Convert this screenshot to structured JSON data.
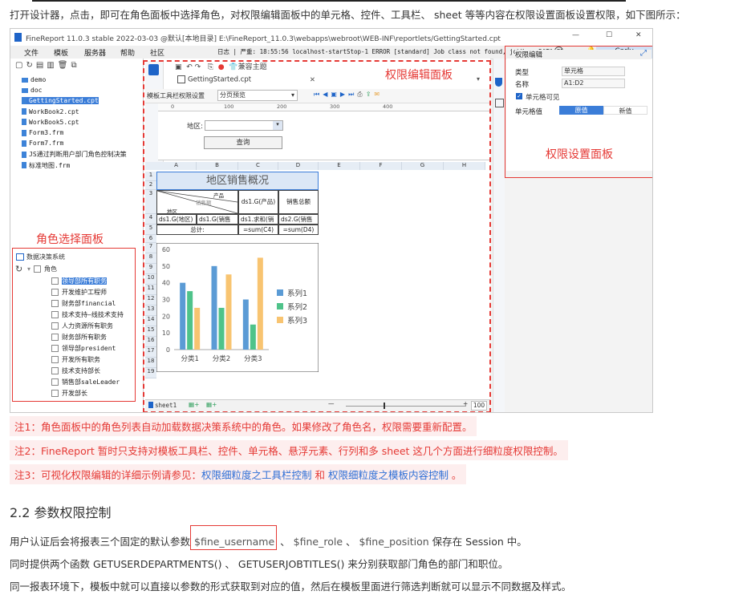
{
  "intro_text": "打开设计器，点击，即可在角色面板中选择角色，对权限编辑面板中的单元格、控件、工具栏、 sheet 等等内容在权限设置面板设置权限，如下图所示：",
  "app": {
    "title": "FineReport 11.0.3 stable 2022-03-03 @默认[本地目录]   E:\\FineReport_11.0.3\\webapps\\webroot\\WEB-INF\\reportlets/GettingStarted.cpt",
    "window_controls": [
      "—",
      "☐",
      "✕"
    ],
    "menu": [
      "文件",
      "模板",
      "服务器",
      "帮助",
      "社区"
    ],
    "log_text": "日志 | 严重: 18:55:56 localhost-startStop-1 ERROR [standard] Job class not found, jobKey: DATA_PRE...",
    "user": "Carly",
    "theme_label": "兼容主题",
    "tab_name": "GettingStarted.cpt",
    "file_tree": [
      {
        "type": "folder",
        "name": "demo"
      },
      {
        "type": "folder",
        "name": "doc"
      },
      {
        "type": "file",
        "name": "GettingStarted.cpt"
      },
      {
        "type": "file",
        "name": "WorkBook2.cpt"
      },
      {
        "type": "file",
        "name": "WorkBook5.cpt"
      },
      {
        "type": "file",
        "name": "Form3.frm"
      },
      {
        "type": "file",
        "name": "Form7.frm"
      },
      {
        "type": "file",
        "name": "JS通过判断用户部门角色控制决策"
      },
      {
        "type": "file",
        "name": "标准地图.frm"
      }
    ],
    "role_panel": {
      "label": "角色选择面板",
      "system": "数据决策系统",
      "group": "角色",
      "roles": [
        "领导部所有职务",
        "开发维护工程师",
        "财务部financial",
        "技术支持—线技术支持",
        "人力资源所有职务",
        "财务部所有职务",
        "领导部president",
        "开发所有职务",
        "技术支持部长",
        "销售部saleLeader",
        "开发部长"
      ]
    },
    "edit_panel": {
      "label": "权限编辑面板",
      "toolbar_label": "模板工具栏权限设置",
      "paging": "分页预览",
      "ruler": [
        "0",
        "100",
        "200",
        "300",
        "400"
      ],
      "param_label": "地区:",
      "query_button": "查询",
      "columns": [
        "A",
        "B",
        "C",
        "D",
        "E",
        "F",
        "G",
        "H"
      ],
      "rows": [
        "1",
        "2",
        "3",
        "4",
        "5",
        "6",
        "7",
        "8",
        "9",
        "10",
        "11",
        "12",
        "13",
        "14",
        "15",
        "16",
        "17",
        "18",
        "19"
      ],
      "report_title": "地区销售概况",
      "header_product": "产品",
      "header_region": "地区",
      "header_sales": "销售额",
      "c3": "ds1.G(产品)",
      "d3": "销售总额",
      "a4": "ds1.G(地区)",
      "b4": "ds1.G(销售",
      "c4": "ds1.求和(销",
      "d4": "ds2.G(销售",
      "b5": "总计:",
      "c5": "=sum(C4)",
      "d5": "=sum(D4)",
      "sheet": "sheet1",
      "zoom": "100"
    },
    "perm_panel": {
      "label": "权限设置面板",
      "header": "权限编辑",
      "type_label": "类型",
      "type_value": "单元格",
      "name_label": "名称",
      "name_value": "A1:D2",
      "visible_label": "单元格可见",
      "value_label": "单元格值",
      "opt_original": "原值",
      "opt_new": "新值"
    }
  },
  "chart_data": {
    "type": "bar",
    "categories": [
      "分类1",
      "分类2",
      "分类3"
    ],
    "series": [
      {
        "name": "系列1",
        "values": [
          40,
          50,
          30
        ],
        "color": "#5b9bd5"
      },
      {
        "name": "系列2",
        "values": [
          35,
          25,
          15
        ],
        "color": "#4fc38a"
      },
      {
        "name": "系列3",
        "values": [
          25,
          45,
          55
        ],
        "color": "#f8c471"
      }
    ],
    "yticks": [
      "0",
      "10",
      "20",
      "30",
      "40",
      "50",
      "60"
    ],
    "ylim": [
      0,
      60
    ],
    "legend": "right"
  },
  "notes": [
    {
      "text": "注1：角色面板中的角色列表自动加载数据决策系统中的角色。如果修改了角色名，权限需要重新配置。"
    },
    {
      "text": "注2：FineReport 暂时只支持对模板工具栏、控件、单元格、悬浮元素、行列和多 sheet 这几个方面进行细粒度权限控制。"
    },
    {
      "prefix": "注3：可视化权限编辑的详细示例请参见：",
      "link1": "权限细粒度之工具栏控制",
      "mid": " 和 ",
      "link2": "权限细粒度之模板内容控制",
      "suffix": " 。"
    }
  ],
  "section": {
    "title": "2.2 参数权限控制",
    "p1_pre": "用户认证后会将报表三个固定的默认参数",
    "p1_code1": " $fine_username",
    "p1_sep1": " 、",
    "p1_code2": " $fine_role",
    "p1_sep2": " 、",
    "p1_code3": " $fine_position",
    "p1_post": " 保存在 Session 中。",
    "p2": "同时提供两个函数 GETUSERDEPARTMENTS() 、 GETUSERJOBTITLES() 来分别获取部门角色的部门和职位。",
    "p3": "同一报表环境下，模板中就可以直接以参数的形式获取到对应的值，然后在模板里面进行筛选判断就可以显示不同数据及样式。"
  }
}
